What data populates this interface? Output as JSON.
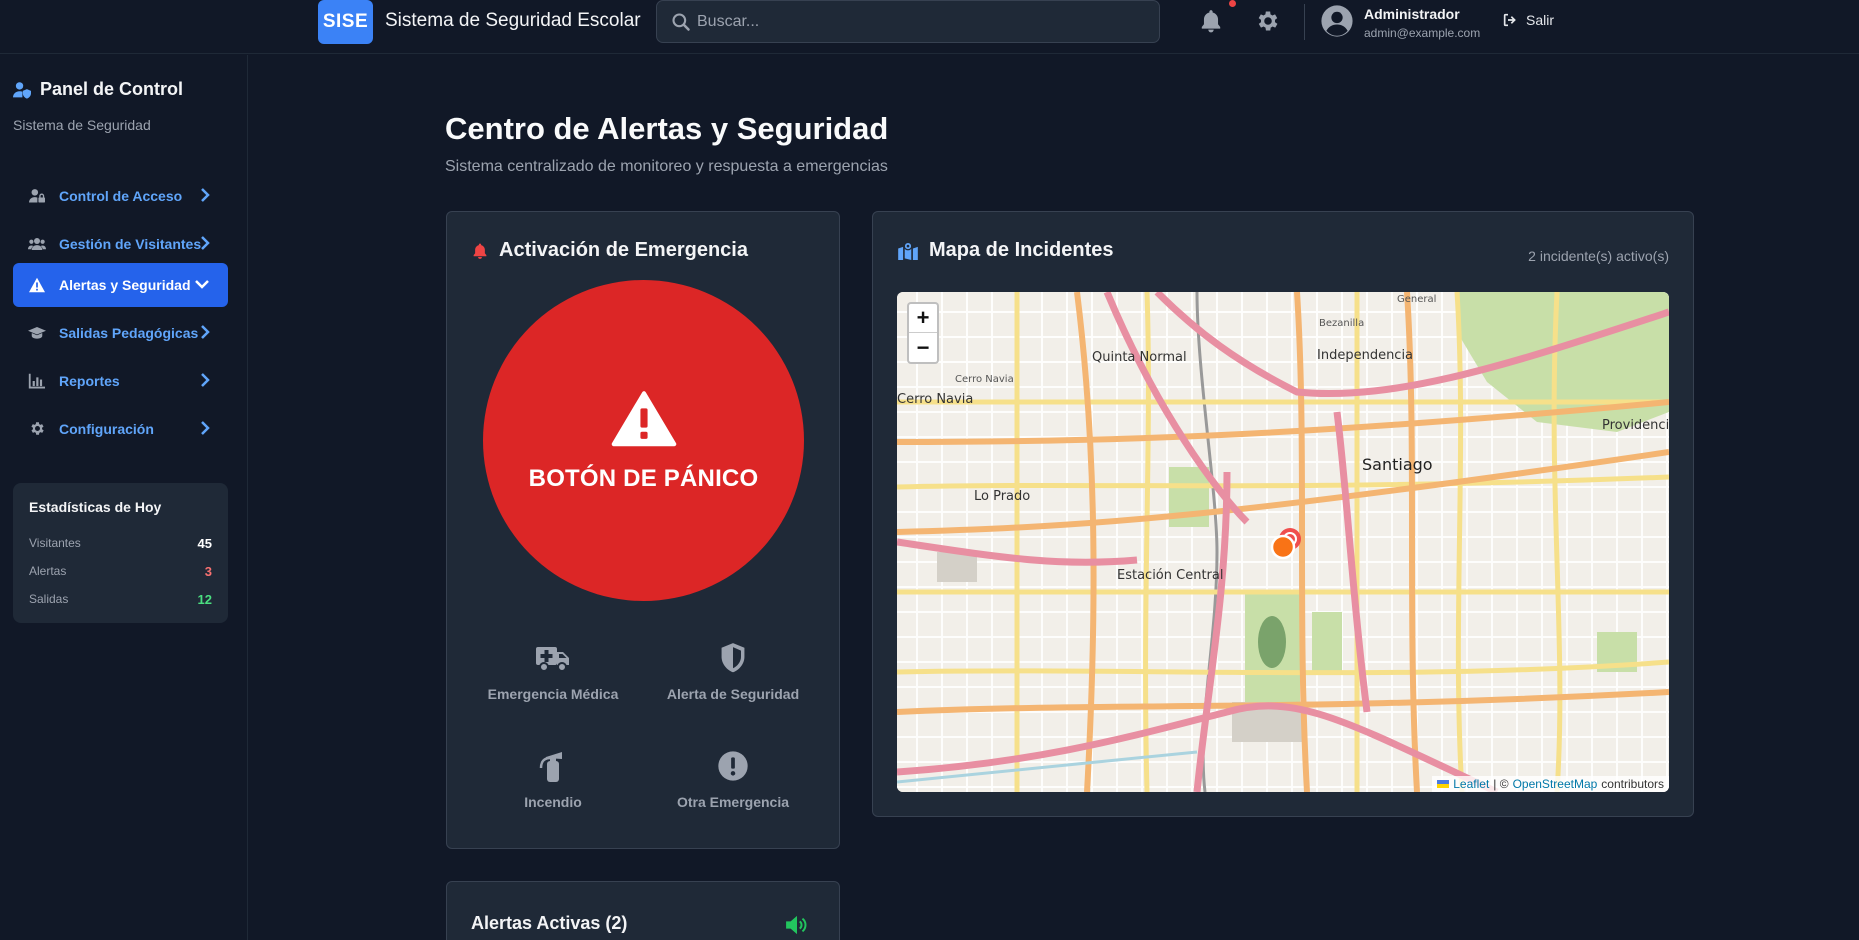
{
  "header": {
    "logo": "SISE",
    "app_title": "Sistema de Seguridad Escolar",
    "search_placeholder": "Buscar...",
    "user_name": "Administrador",
    "user_email": "admin@example.com",
    "logout_label": "Salir"
  },
  "sidebar": {
    "title": "Panel de Control",
    "subtitle": "Sistema de Seguridad",
    "items": [
      {
        "label": "Control de Acceso",
        "icon": "user-lock-icon",
        "active": false
      },
      {
        "label": "Gestión de Visitantes",
        "icon": "users-icon",
        "active": false
      },
      {
        "label": "Alertas y Seguridad",
        "icon": "warning-icon",
        "active": true
      },
      {
        "label": "Salidas Pedagógicas",
        "icon": "graduation-cap-icon",
        "active": false
      },
      {
        "label": "Reportes",
        "icon": "chart-icon",
        "active": false
      },
      {
        "label": "Configuración",
        "icon": "gear-icon",
        "active": false
      }
    ],
    "stats": {
      "title": "Estadísticas de Hoy",
      "rows": [
        {
          "label": "Visitantes",
          "value": "45",
          "color": "#ffffff"
        },
        {
          "label": "Alertas",
          "value": "3",
          "color": "#f87171"
        },
        {
          "label": "Salidas",
          "value": "12",
          "color": "#4ade80"
        }
      ]
    }
  },
  "main": {
    "title": "Centro de Alertas y Seguridad",
    "subtitle": "Sistema centralizado de monitoreo y respuesta a emergencias",
    "emergency": {
      "title": "Activación de Emergencia",
      "panic_label": "BOTÓN DE PÁNICO",
      "options": [
        {
          "label": "Emergencia Médica",
          "icon": "ambulance-icon"
        },
        {
          "label": "Alerta de Seguridad",
          "icon": "shield-icon"
        },
        {
          "label": "Incendio",
          "icon": "fire-extinguisher-icon"
        },
        {
          "label": "Otra Emergencia",
          "icon": "exclamation-circle-icon"
        }
      ]
    },
    "map": {
      "title": "Mapa de Incidentes",
      "incidents_count": "2 incidente(s) activo(s)",
      "zoom_in": "+",
      "zoom_out": "−",
      "attribution_leaflet": "Leaflet",
      "attribution_sep": "| ©",
      "attribution_osm": "OpenStreetMap",
      "attribution_tail": "contributors",
      "places": {
        "quinta_normal": "Quinta Normal",
        "independencia": "Independencia",
        "cerro_navia": "Cerro Navia",
        "cerro_navia_2": "Cerro Navia",
        "santiago": "Santiago",
        "providencia": "Providencia",
        "lo_prado": "Lo Prado",
        "estacion_central": "Estación Central",
        "general": "General",
        "bezanilla": "Bezanilla"
      }
    },
    "alerts": {
      "title": "Alertas Activas (2)"
    }
  },
  "colors": {
    "background": "#111827",
    "panel": "#1f2937",
    "accent": "#2563eb",
    "link": "#60a5fa",
    "panic": "#dc2626"
  }
}
